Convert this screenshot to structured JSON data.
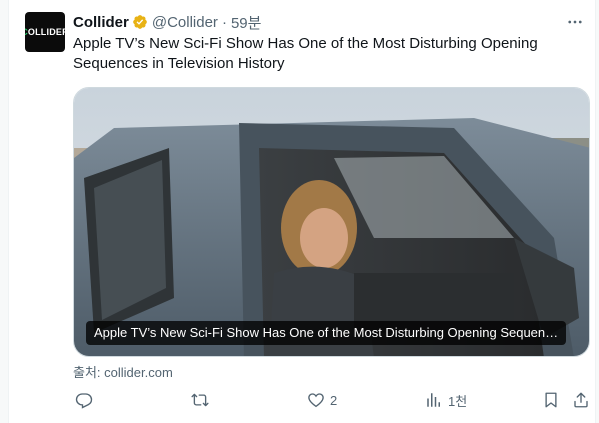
{
  "account": {
    "display_name": "Collider",
    "handle": "@Collider",
    "separator": "·",
    "time": "59분",
    "avatar_text_c": "C",
    "avatar_text_rest": "OLLIDER",
    "verified_color": "#e8b214"
  },
  "tweet": {
    "text": "Apple TV’s New Sci-Fi Show Has One of the Most Disturbing Opening Sequences in Television History"
  },
  "card": {
    "caption": "Apple TV’s New Sci-Fi Show Has One of the Most Disturbing Opening Sequen…",
    "source": "출처: collider.com"
  },
  "actions": {
    "reply": {
      "icon": "reply-icon",
      "count": ""
    },
    "retweet": {
      "icon": "retweet-icon",
      "count": ""
    },
    "like": {
      "icon": "heart-icon",
      "count": "2"
    },
    "views": {
      "icon": "views-icon",
      "count": "1천"
    },
    "bookmark": {
      "icon": "bookmark-icon"
    },
    "share": {
      "icon": "share-icon"
    }
  },
  "colors": {
    "text_primary": "#0f1419",
    "text_secondary": "#536471",
    "border": "#cfd9de",
    "brand_green": "#21c063"
  }
}
